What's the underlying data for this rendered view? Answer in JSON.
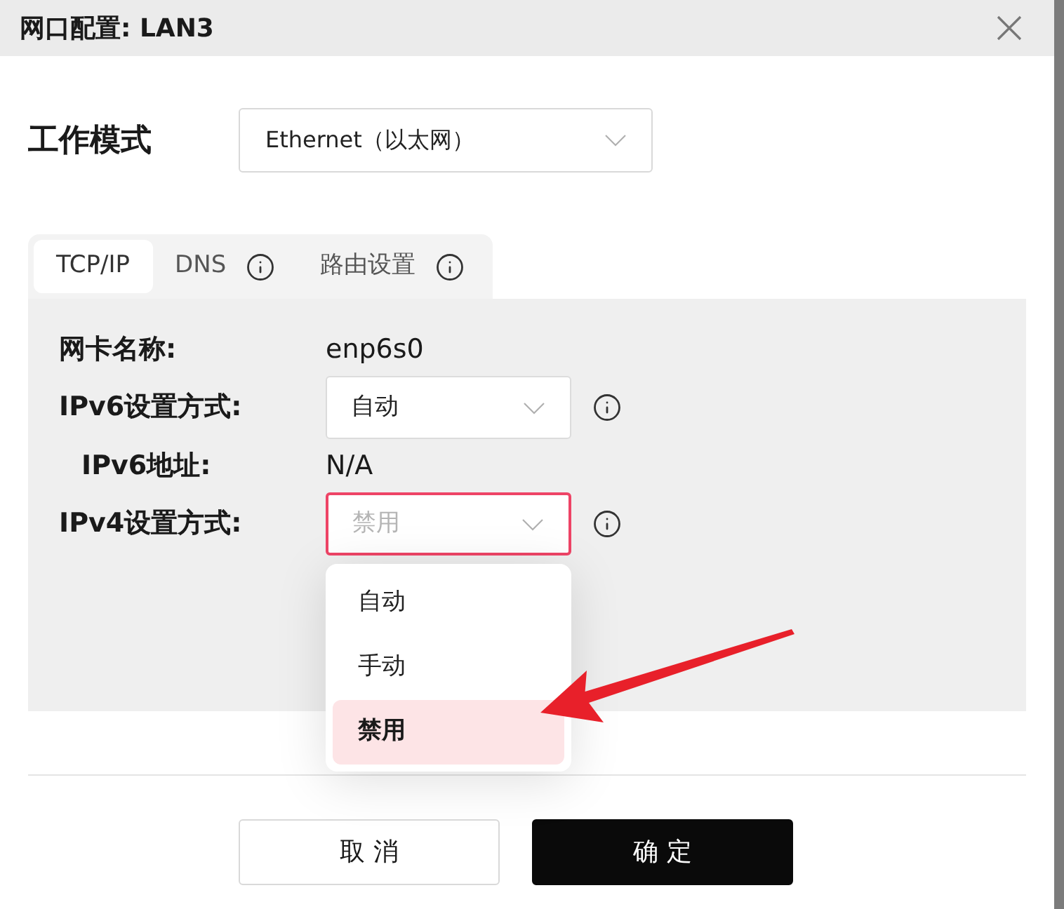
{
  "window": {
    "title": "网口配置: LAN3"
  },
  "work_mode": {
    "label": "工作模式",
    "value": "Ethernet（以太网）"
  },
  "tabs": [
    {
      "label": "TCP/IP",
      "selected": true,
      "info": false
    },
    {
      "label": "DNS",
      "selected": false,
      "info": true
    },
    {
      "label": "路由设置",
      "selected": false,
      "info": true
    }
  ],
  "fields": [
    {
      "kind": "text",
      "label": "网卡名称:",
      "value": "enp6s0"
    },
    {
      "kind": "select",
      "label": "IPv6设置方式:",
      "value": "自动",
      "info": true,
      "expanded": false,
      "children": [
        {
          "kind": "text",
          "label": "IPv6地址:",
          "value": "N/A"
        }
      ]
    },
    {
      "kind": "select",
      "label": "IPv4设置方式:",
      "value": "禁用",
      "info": true,
      "expanded": true,
      "options": [
        {
          "label": "自动",
          "selected": false
        },
        {
          "label": "手动",
          "selected": false
        },
        {
          "label": "禁用",
          "selected": true
        }
      ]
    }
  ],
  "buttons": [
    {
      "label": "取消",
      "kind": "secondary"
    },
    {
      "label": "确定",
      "kind": "primary"
    }
  ]
}
